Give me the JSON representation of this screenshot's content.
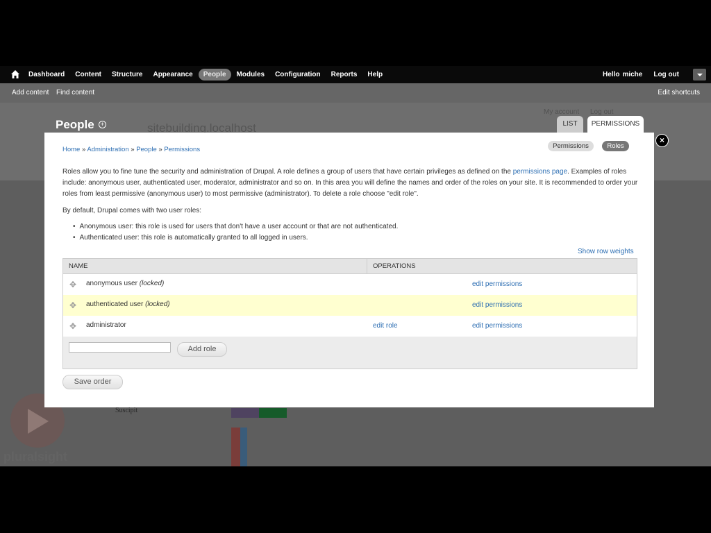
{
  "toolbar": {
    "menu": [
      "Dashboard",
      "Content",
      "Structure",
      "Appearance",
      "People",
      "Modules",
      "Configuration",
      "Reports",
      "Help"
    ],
    "hello": "Hello",
    "user": "miche",
    "logout": "Log out"
  },
  "shortcuts": {
    "add_content": "Add content",
    "find_content": "Find content",
    "edit_shortcuts": "Edit shortcuts"
  },
  "background": {
    "page_title": "People",
    "site_name": "sitebuilding.localhost",
    "my_account": "My account",
    "log_out": "Log out",
    "tabs": [
      "LIST",
      "PERMISSIONS"
    ],
    "footer_text": "Suscipit"
  },
  "watermark": "pluralsight",
  "modal": {
    "breadcrumb": [
      "Home",
      "Administration",
      "People",
      "Permissions"
    ],
    "breadcrumb_sep": "»",
    "pill_permissions": "Permissions",
    "pill_roles": "Roles",
    "intro_1": "Roles allow you to fine tune the security and administration of Drupal. A role defines a group of users that have certain privileges as defined on the ",
    "intro_link": "permissions page",
    "intro_2": ". Examples of roles include: anonymous user, authenticated user, moderator, administrator and so on. In this area you will define the names and order of the roles on your site. It is recommended to order your roles from least permissive (anonymous user) to most permissive (administrator). To delete a role choose \"edit role\".",
    "default_text": "By default, Drupal comes with two user roles:",
    "bullets": [
      "Anonymous user: this role is used for users that don't have a user account or that are not authenticated.",
      "Authenticated user: this role is automatically granted to all logged in users."
    ],
    "show_weights": "Show row weights",
    "table": {
      "headers": [
        "NAME",
        "OPERATIONS"
      ],
      "rows": [
        {
          "name": "anonymous user",
          "locked": "(locked)",
          "edit_role": "",
          "edit_permissions": "edit permissions"
        },
        {
          "name": "authenticated user",
          "locked": "(locked)",
          "edit_role": "",
          "edit_permissions": "edit permissions"
        },
        {
          "name": "administrator",
          "locked": "",
          "edit_role": "edit role",
          "edit_permissions": "edit permissions"
        }
      ],
      "new_role_value": "",
      "add_role": "Add role"
    },
    "save_order": "Save order",
    "close_glyph": "×",
    "row_highlight": "#ffffd0"
  }
}
